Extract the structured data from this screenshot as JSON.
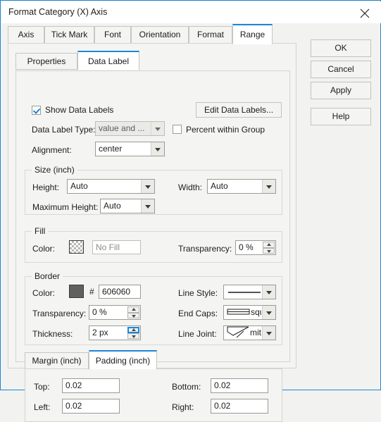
{
  "window": {
    "title": "Format Category (X) Axis",
    "close_icon": "close-icon",
    "accent_color": "#1e86d6"
  },
  "tabs": [
    {
      "label": "Axis",
      "active": false
    },
    {
      "label": "Tick Mark",
      "active": false
    },
    {
      "label": "Font",
      "active": false
    },
    {
      "label": "Orientation",
      "active": false
    },
    {
      "label": "Format",
      "active": false
    },
    {
      "label": "Range",
      "active": true
    }
  ],
  "buttons": {
    "ok": "OK",
    "cancel": "Cancel",
    "apply": "Apply",
    "help": "Help"
  },
  "subtabs": [
    {
      "label": "Properties",
      "active": false
    },
    {
      "label": "Data Label",
      "active": true
    }
  ],
  "data_label": {
    "show_data_labels": {
      "label": "Show Data Labels",
      "checked": true
    },
    "edit_data_labels_button": "Edit Data Labels...",
    "data_label_type": {
      "label": "Data Label Type:",
      "value": "value and ...",
      "disabled": true
    },
    "percent_within_group": {
      "label": "Percent within Group",
      "checked": false
    },
    "alignment": {
      "label": "Alignment:",
      "value": "center"
    }
  },
  "size_group": {
    "title": "Size (inch)",
    "height": {
      "label": "Height:",
      "value": "Auto"
    },
    "width": {
      "label": "Width:",
      "value": "Auto"
    },
    "maximum_height": {
      "label": "Maximum Height:",
      "value": "Auto"
    }
  },
  "fill_group": {
    "title": "Fill",
    "color": {
      "label": "Color:",
      "swatch": "transparent-checker",
      "value": "No Fill"
    },
    "transparency": {
      "label": "Transparency:",
      "value": "0 %"
    }
  },
  "border_group": {
    "title": "Border",
    "color": {
      "label": "Color:",
      "hash": "#",
      "swatch_color": "#606060",
      "value": "606060"
    },
    "transparency": {
      "label": "Transparency:",
      "value": "0 %"
    },
    "thickness": {
      "label": "Thickness:",
      "value": "2 px"
    },
    "line_style": {
      "label": "Line Style:",
      "value": "",
      "preview": "solid-line"
    },
    "end_caps": {
      "label": "End Caps:",
      "value": "squ...",
      "preview": "square-cap"
    },
    "line_joint": {
      "label": "Line Joint:",
      "value": "miter",
      "preview": "miter-joint"
    }
  },
  "spacing_tabs": [
    {
      "label": "Margin (inch)",
      "active": false
    },
    {
      "label": "Padding (inch)",
      "active": true
    }
  ],
  "padding": {
    "top": {
      "label": "Top:",
      "value": "0.02"
    },
    "bottom": {
      "label": "Bottom:",
      "value": "0.02"
    },
    "left": {
      "label": "Left:",
      "value": "0.02"
    },
    "right": {
      "label": "Right:",
      "value": "0.02"
    }
  }
}
